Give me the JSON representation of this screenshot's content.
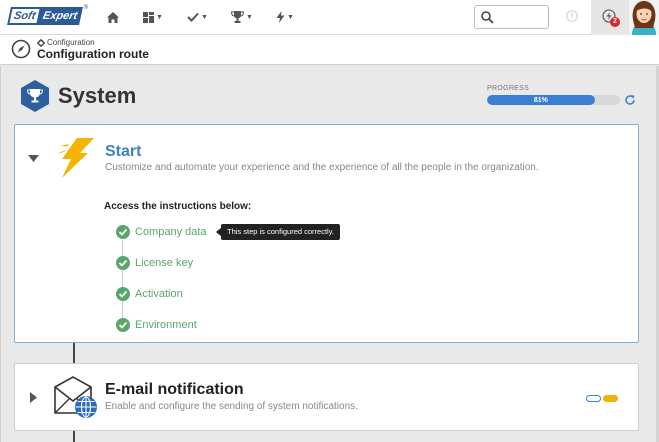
{
  "topbar": {
    "logo": {
      "part1": "Soft",
      "part2": "Expert",
      "reg": "®"
    },
    "nav": [
      {
        "name": "home",
        "icon": "home-icon",
        "has_caret": false
      },
      {
        "name": "dashboard",
        "icon": "grid-icon",
        "has_caret": true
      },
      {
        "name": "tasks",
        "icon": "check-icon",
        "has_caret": true
      },
      {
        "name": "achievements",
        "icon": "trophy-icon",
        "has_caret": true
      },
      {
        "name": "actions",
        "icon": "lightning-icon",
        "has_caret": true
      }
    ],
    "search": {
      "value": "",
      "placeholder": ""
    },
    "notifications": {
      "count": "2"
    }
  },
  "breadcrumb": {
    "parent": "Configuration",
    "title": "Configuration route"
  },
  "system": {
    "title": "System",
    "progress_label": "PROGRESS",
    "progress_text": "81%",
    "progress_value": 0.81
  },
  "start_card": {
    "title": "Start",
    "description": "Customize and automate your experience and the experience of all the people in the organization.",
    "instructions": "Access the instructions below:",
    "steps": [
      {
        "label": "Company data",
        "status": "done"
      },
      {
        "label": "License key",
        "status": "done"
      },
      {
        "label": "Activation",
        "status": "done"
      },
      {
        "label": "Environment",
        "status": "done"
      }
    ],
    "tooltip": "This step is configured correctly."
  },
  "email_card": {
    "title": "E-mail notification",
    "description": "Enable and configure the sending of system notifications."
  },
  "colors": {
    "accent_blue": "#3e7fc6",
    "success_green": "#5aa56a",
    "brand_navy": "#2b5a96",
    "warning_yellow": "#f0b400"
  }
}
